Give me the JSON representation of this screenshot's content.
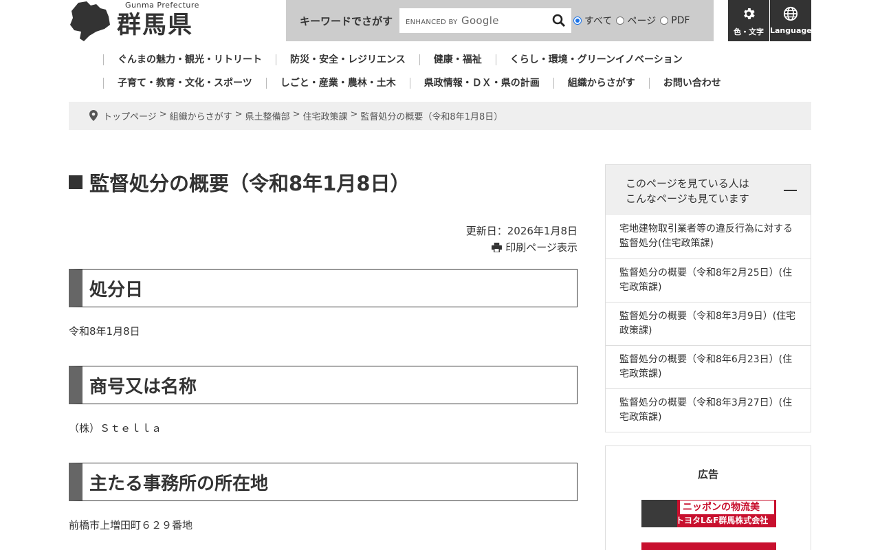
{
  "header": {
    "logo_en": "Gunma Prefecture",
    "logo_jp": "群馬県",
    "search": {
      "label": "キーワードでさがす",
      "brand_prefix": "ENHANCED BY",
      "brand_name": "Google",
      "options": [
        {
          "label": "すべて",
          "checked": true
        },
        {
          "label": "ページ",
          "checked": false
        },
        {
          "label": "PDF",
          "checked": false
        }
      ]
    },
    "tools": {
      "color_label": "色・文字",
      "language_label": "Language"
    }
  },
  "nav": {
    "row1": [
      "ぐんまの魅力・観光・リトリート",
      "防災・安全・レジリエンス",
      "健康・福祉",
      "くらし・環境・グリーンイノベーション"
    ],
    "row2": [
      "子育て・教育・文化・スポーツ",
      "しごと・産業・農林・土木",
      "県政情報・ＤＸ・県の計画",
      "組織からさがす",
      "お問い合わせ"
    ]
  },
  "breadcrumb": [
    "トップページ",
    "組織からさがす",
    "県土整備部",
    "住宅政策課",
    "監督処分の概要（令和8年1月8日）"
  ],
  "main": {
    "title": "監督処分の概要（令和8年1月8日）",
    "updated": "更新日：2026年1月8日",
    "print_label": "印刷ページ表示",
    "sections": [
      {
        "heading": "処分日",
        "body": "令和8年1月8日"
      },
      {
        "heading": "商号又は名称",
        "body": "（株）Ｓｔｅｌｌａ"
      },
      {
        "heading": "主たる事務所の所在地",
        "body": "前橋市上増田町６２９番地"
      }
    ]
  },
  "sidebar": {
    "heading_line1": "このページを見ている人は",
    "heading_line2": "こんなページも見ています",
    "items": [
      "宅地建物取引業者等の違反行為に対する監督処分(住宅政策課)",
      "監督処分の概要（令和8年2月25日）(住宅政策課)",
      "監督処分の概要（令和8年3月9日）(住宅政策課)",
      "監督処分の概要（令和8年6月23日）(住宅政策課)",
      "監督処分の概要（令和8年3月27日）(住宅政策課)"
    ]
  },
  "ad": {
    "title": "広告",
    "banner_line1": "ニッポンの物流美",
    "banner_line2": "トヨタL&F群馬株式会社"
  },
  "colors": {
    "brand_dark": "#333333",
    "search_bg": "#cccccc",
    "heading_accent": "#666666",
    "breadcrumb_bg": "#efefef",
    "ad_red": "#c8102e"
  }
}
